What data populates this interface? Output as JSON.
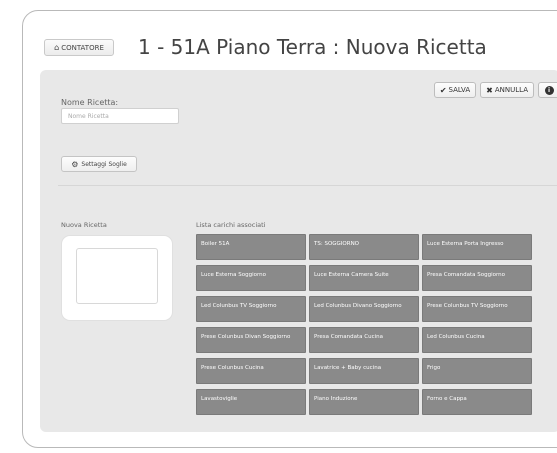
{
  "header": {
    "home_button_label": "CONTATORE",
    "home_icon": "home-icon",
    "title": "1 - 51A Piano Terra : Nuova Ricetta"
  },
  "toolbar": {
    "save_label": "SALVA",
    "save_icon": "check-icon",
    "cancel_label": "ANNULLA",
    "cancel_icon": "x-icon",
    "info_icon": "info-icon"
  },
  "form": {
    "name_label": "Nome Ricetta:",
    "name_value": "",
    "name_placeholder": "Nome Ricetta",
    "thresholds_button_label": "Settaggi Soglie",
    "thresholds_icon": "gear-icon"
  },
  "recipe_preview": {
    "label": "Nuova Ricetta"
  },
  "loads": {
    "label": "Lista carichi associati",
    "items": [
      "Boiler 51A",
      "TS: SOGGIORNO",
      "Luce Esterna Porta Ingresso",
      "Luce Esterna Soggiorno",
      "Luce Esterna Camera Suite",
      "Presa Comandata Soggiorno",
      "Led Colunbus TV Soggiorno",
      "Led Colunbus Divano Soggiorno",
      "Prese Colunbus TV Soggiorno",
      "Prese Colunbus Divan Soggiorno",
      "Presa Comandata Cucina",
      "Led Colunbus Cucina",
      "Prese Colunbus Cucina",
      "Lavatrice + Baby cucina",
      "Frigo",
      "Lavastoviglie",
      "Piano Induzione",
      "Forno e Cappa"
    ]
  },
  "colors": {
    "tile_background": "#8a8a8a",
    "panel_background": "#e8e8e8"
  }
}
